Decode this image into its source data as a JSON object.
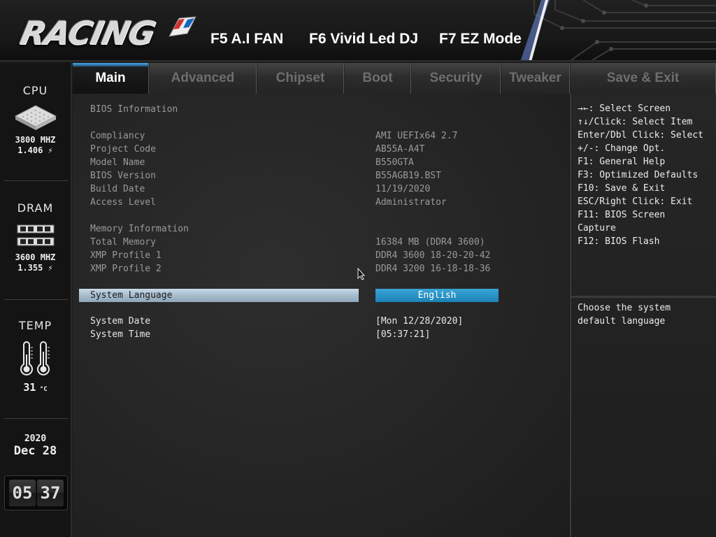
{
  "header": {
    "logo_text": "RACING",
    "hotkeys": [
      "F5 A.I FAN",
      "F6 Vivid Led DJ",
      "F7 EZ Mode"
    ]
  },
  "sidebar": {
    "cpu": {
      "title": "CPU",
      "freq": "3800 MHZ",
      "volt": "1.406"
    },
    "dram": {
      "title": "DRAM",
      "freq": "3600 MHZ",
      "volt": "1.355"
    },
    "temp": {
      "title": "TEMP",
      "value": "31"
    },
    "date": {
      "year": "2020",
      "month": "Dec",
      "day": "28"
    },
    "clock": {
      "hour": "05",
      "minute": "37"
    }
  },
  "tabs": [
    "Main",
    "Advanced",
    "Chipset",
    "Boot",
    "Security",
    "Tweaker",
    "Save & Exit"
  ],
  "active_tab": "Main",
  "main": {
    "bios_section": "BIOS Information",
    "bios_rows": [
      {
        "label": "Compliancy",
        "value": "AMI UEFIx64 2.7"
      },
      {
        "label": "Project Code",
        "value": "AB55A-A4T"
      },
      {
        "label": "Model Name",
        "value": "B550GTA"
      },
      {
        "label": "BIOS Version",
        "value": "B55AGB19.BST"
      },
      {
        "label": "Build Date",
        "value": "11/19/2020"
      },
      {
        "label": "Access Level",
        "value": "Administrator"
      }
    ],
    "memory_section": "Memory Information",
    "memory_rows": [
      {
        "label": "Total Memory",
        "value": "16384 MB (DDR4 3600)"
      },
      {
        "label": "XMP Profile 1",
        "value": "DDR4 3600 18-20-20-42"
      },
      {
        "label": "XMP Profile 2",
        "value": "DDR4 3200 16-18-18-36"
      }
    ],
    "language": {
      "label": "System Language",
      "value": "English"
    },
    "date": {
      "label": "System Date",
      "value": "[Mon 12/28/2020]"
    },
    "time": {
      "label": "System Time",
      "value": "[05:37:21]"
    }
  },
  "help": {
    "keys": [
      "→←: Select Screen",
      "↑↓/Click: Select Item",
      "Enter/Dbl Click: Select",
      "+/-: Change Opt.",
      "F1: General Help",
      "F3: Optimized Defaults",
      "F10: Save & Exit",
      "ESC/Right Click: Exit",
      "F11: BIOS Screen",
      "Capture",
      "F12: BIOS Flash"
    ],
    "description": [
      "Choose the system",
      "default language"
    ]
  },
  "colors": {
    "accent_blue": "#1c82b6",
    "highlight_bar": "#a6bccd",
    "background": "#242424"
  }
}
